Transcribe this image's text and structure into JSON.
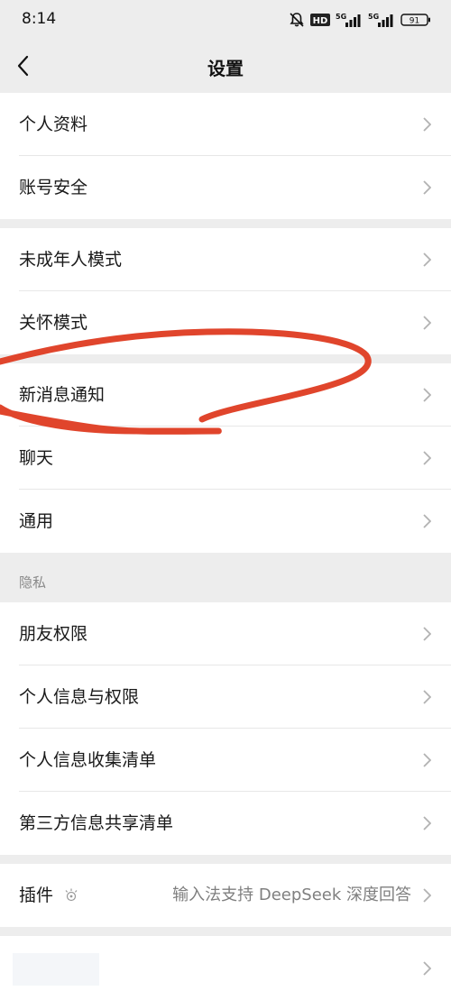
{
  "status_bar": {
    "time": "8:14",
    "signal_1": "5G",
    "signal_2": "5G",
    "battery": "91",
    "hd_badge": "HD",
    "icons": [
      "mute-bell-icon",
      "hd-icon",
      "signal-icon",
      "signal-icon",
      "battery-icon"
    ]
  },
  "nav": {
    "title": "设置",
    "back_icon": "chevron-left-icon"
  },
  "groups": [
    {
      "items": [
        {
          "label": "个人资料"
        },
        {
          "label": "账号安全"
        }
      ]
    },
    {
      "items": [
        {
          "label": "未成年人模式"
        },
        {
          "label": "关怀模式"
        }
      ]
    },
    {
      "items": [
        {
          "label": "新消息通知"
        },
        {
          "label": "聊天"
        },
        {
          "label": "通用"
        }
      ]
    },
    {
      "items": [
        {
          "label": "朋友权限"
        },
        {
          "label": "个人信息与权限"
        },
        {
          "label": "个人信息收集清单"
        },
        {
          "label": "第三方信息共享清单"
        }
      ]
    }
  ],
  "privacy_section_label": "隐私",
  "plugins": {
    "label": "插件",
    "value": "输入法支持 DeepSeek 深度回答",
    "icon": "sparkle-icon"
  },
  "colors": {
    "background": "#ededed",
    "row_bg": "#ffffff",
    "text": "#191919",
    "secondary_text": "#7f7f7f",
    "annotation_red": "#e0452c"
  }
}
